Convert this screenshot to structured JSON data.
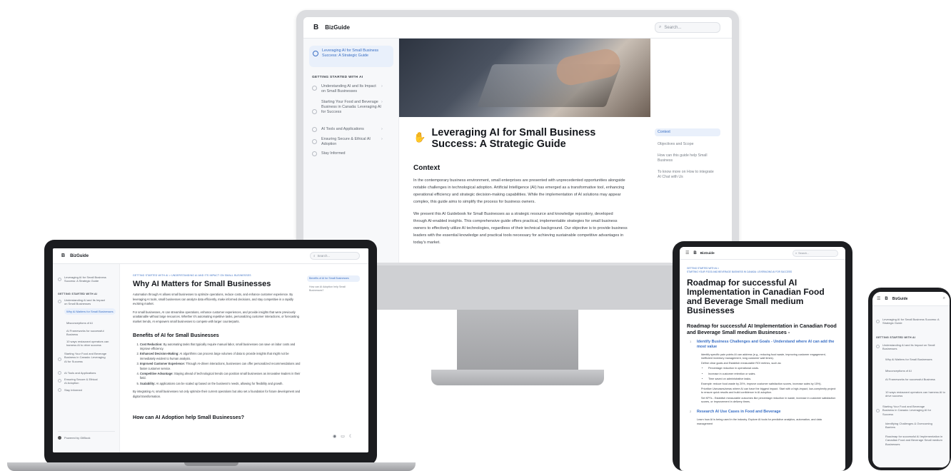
{
  "brand": {
    "logo_letter": "B",
    "name": "BizGuide"
  },
  "search": {
    "placeholder": "Search..."
  },
  "monitor": {
    "sidebar": {
      "active_title": "Leveraging AI for Small Business Success: A Strategic Guide",
      "section": "GETTING STARTED WITH AI",
      "items": [
        "Understanding AI and Its Impact on Small Businesses",
        "Starting Your Food and Beverage Business in Canada: Leveraging AI for Success",
        "AI Tools and Applications",
        "Ensuring Secure & Ethical AI Adoption",
        "Stay Informed"
      ]
    },
    "title": "Leveraging AI for Small Business Success: A Strategic Guide",
    "context_heading": "Context",
    "para1": "In the contemporary business environment, small enterprises are presented with unprecedented opportunities alongside notable challenges in technological adoption. Artificial Intelligence (AI) has emerged as a transformative tool, enhancing operational efficiency and strategic decision-making capabilities. While the implementation of AI solutions may appear complex, this guide aims to simplify the process for business owners.",
    "para2": "We present this AI Guidebook for Small Businesses as a strategic resource and knowledge repository, developed through AI-enabled insights. This comprehensive guide offers practical, implementable strategies for small business owners to effectively utilize AI technologies, regardless of their technical background. Our objective is to provide business leaders with the essential knowledge and practical tools necessary for achieving sustainable competitive advantages in today's market.",
    "toc": [
      "Context",
      "Objectives and Scope",
      "How can this guide help Small Business",
      "To know more on How to integrate AI Chat with Us"
    ]
  },
  "laptop": {
    "sidebar": {
      "top": "Leveraging AI for Small Business Success: A Strategic Guide",
      "section": "GETTING STARTED WITH AI",
      "item1": "Understanding AI and Its Impact on Small Businesses",
      "subs": [
        "Why AI Matters for Small Businesses",
        "Misconceptions of AI",
        "AI Frameworks for successful Business",
        "10 ways restaurant operators can harness AI to drive success"
      ],
      "items": [
        "Starting Your Food and Beverage Business in Canada: Leveraging AI for Success",
        "AI Tools and Applications",
        "Ensuring Secure & Ethical AI Adoption",
        "Stay Informed"
      ],
      "powered": "Powered by GitBook"
    },
    "breadcrumb": "GETTING STARTED WITH AI  >  UNDERSTANDING AI AND ITS IMPACT ON SMALL BUSINESSES",
    "title": "Why AI Matters for Small Businesses",
    "p1": "Automation through AI allows small businesses to optimize operations, reduce costs, and enhance customer experience. By leveraging AI tools, small businesses can analyze data efficiently, make informed decisions, and stay competitive in a rapidly evolving market.",
    "p2": "For small businesses, AI can streamline operations, enhance customer experiences, and provide insights that were previously unattainable without large resources. Whether it's automating repetitive tasks, personalizing customer interactions, or forecasting market trends, AI empowers small businesses to compete with larger counterparts.",
    "benefits_heading": "Benefits of AI for Small Businesses",
    "benefits": [
      {
        "b": "Cost Reduction:",
        "t": " By automating tasks that typically require manual labor, small businesses can save on labor costs and improve efficiency."
      },
      {
        "b": "Enhanced Decision-Making:",
        "t": " AI algorithms can process large volumes of data to provide insights that might not be immediately evident to human analysis."
      },
      {
        "b": "Improved Customer Experience:",
        "t": " Through AI-driven interactions, businesses can offer personalized recommendations and faster customer service."
      },
      {
        "b": "Competitive Advantage:",
        "t": " Staying ahead of technological trends can position small businesses as innovative leaders in their field."
      },
      {
        "b": "Scalability:",
        "t": " AI applications can be scaled up based on the business's needs, allowing for flexibility and growth."
      }
    ],
    "p3": "By integrating AI, small businesses not only optimize their current operations but also set a foundation for future development and digital transformation.",
    "next_heading": "How can AI Adoption help Small Businesses?",
    "toc": [
      "Benefits of AI for Small Businesses",
      "How can AI Adoption help Small Businesses?"
    ]
  },
  "tablet": {
    "breadcrumb1": "GETTING STARTED WITH AI  >",
    "breadcrumb2": "STARTING YOUR FOOD AND BEVERAGE BUSINESS IN CANADA: LEVERAGING AI FOR SUCCESS",
    "title": "Roadmap for successful AI Implementation in Canadian Food and Beverage Small medium Businesses",
    "subtitle": "Roadmap for successful AI Implementation in Canadian Food and Beverage Small medium Businesses -",
    "step1_num": "1",
    "step1": "Identify Business Challenges and Goals - Understand where AI can add the most value",
    "step1_p1": "Identify specific pain points AI can address (e.g., reducing food waste, improving customer engagement, inefficient inventory management, long customer wait times).",
    "step1_p2": "Define clear goals and Establish measurable ROI metrics, such as:",
    "bullets": [
      "Percentage reduction in operational costs.",
      "Increase in customer retention or sales.",
      "Time saved on administrative tasks."
    ],
    "step1_p3": "Example: reduce food waste by 20%, improve customer satisfaction scores, increase sales by 15%).",
    "step1_p4": "Prioritize Usecases/areas where AI can have the biggest impact. Start with a high-impact, low-complexity project to ensure quick results and build confidence in AI adoption.",
    "step1_p5": "Set KPI's - Establish measurable outcomes like percentage reduction in waste, increase in customer satisfaction scores, or improvement in delivery times.",
    "step2_num": "2",
    "step2": "Research AI Use Cases in Food and Beverage",
    "step2_p1": "Learn how AI is being used in the industry. Explore AI tools for predictive analytics, automation, and data management"
  },
  "phone": {
    "top": "Leveraging AI for Small Business Success: A Strategic Guide",
    "section": "GETTING STARTED WITH AI",
    "item1": "Understanding AI and its Impact on Small Businesses",
    "subs": [
      "Why AI Matters for Small Businesses",
      "Misconceptions of AI",
      "AI Frameworks for successful Business",
      "10 ways restaurant operators can harness AI to drive success"
    ],
    "item2": "Starting Your Food and Beverage Business in Canada: Leveraging AI for Success",
    "subs2": [
      "Identifying Challenges & Overcoming Barriers",
      "Roadmap for successful AI Implementation in Canadian Food and Beverage Small medium Businesses"
    ]
  }
}
